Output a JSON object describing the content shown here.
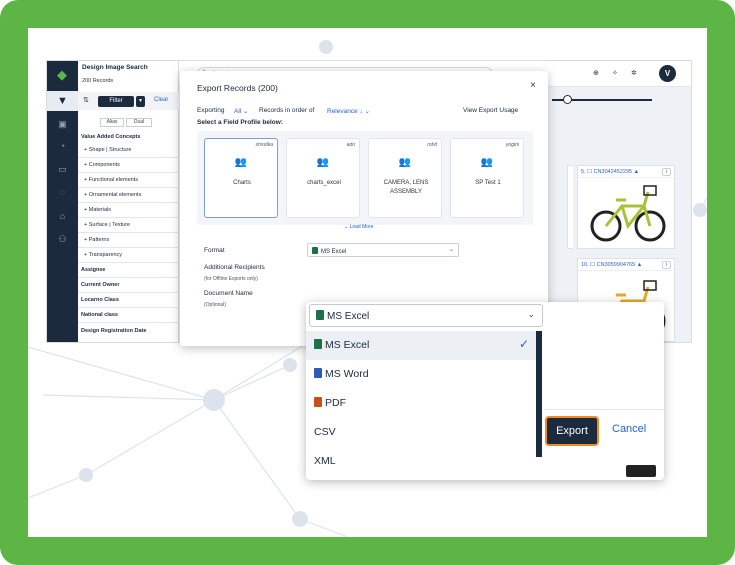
{
  "colors": {
    "frame": "#5cb545",
    "navy": "#1c2a3d",
    "link": "#2a62c9",
    "export_outline": "#f08a24",
    "excel": "#1e7145",
    "word": "#2b5ab8",
    "pdf": "#c4511c"
  },
  "sidebar": {
    "title": "Design Image Search",
    "records": "200 Records",
    "filter_label": "Filter",
    "clear_label": "Clear",
    "toggles": [
      "Alias",
      "Dual"
    ],
    "items": [
      "Value Added Concepts",
      "+ Shape | Structure",
      "+ Components",
      "+ Functional elements",
      "+ Ornamental elements",
      "+ Materials",
      "+ Surface | Texture",
      "+ Patterns",
      "+ Transparency",
      "Assignee",
      "Current Owner",
      "Locarno Class",
      "National class",
      "Design Registration Date"
    ]
  },
  "topbar": {
    "search_placeholder": "Search",
    "avatar": "V"
  },
  "cards": [
    {
      "id": "5. ☐ CN3042452295 ▲"
    },
    {
      "id": "10. ☐ CN3059904765 ▲"
    }
  ],
  "modal": {
    "title": "Export Records (200)",
    "close": "×",
    "exporting_label": "Exporting",
    "exporting_value": "All ⌄",
    "order_label": "Records in order of",
    "order_value": "Relevance ↓ ⌄",
    "view_usage": "View Export Usage",
    "profile_prompt": "Select a Field Profile below:",
    "profiles": [
      {
        "owner": "shrutika",
        "name": "Charts"
      },
      {
        "owner": "ado",
        "name": "charts_excel"
      },
      {
        "owner": "rohit",
        "name": "CAMERA, LENS ASSEMBLY"
      },
      {
        "owner": "yogini",
        "name": "SP Test 1"
      }
    ],
    "load_more": "⌄ Load More",
    "format_label": "Format",
    "format_value": "MS Excel",
    "recipients_label": "Additional Recipients",
    "recipients_hint": "(for Offline Exports only)",
    "docname_label": "Document Name",
    "docname_hint": "(Optional)"
  },
  "dropdown": {
    "selected": "MS Excel",
    "options": [
      {
        "label": "MS Excel",
        "icon": "excel-icon"
      },
      {
        "label": "MS Word",
        "icon": "word-icon"
      },
      {
        "label": "PDF",
        "icon": "pdf-icon"
      },
      {
        "label": "CSV",
        "icon": ""
      },
      {
        "label": "XML",
        "icon": ""
      }
    ],
    "export_label": "Export",
    "cancel_label": "Cancel"
  }
}
